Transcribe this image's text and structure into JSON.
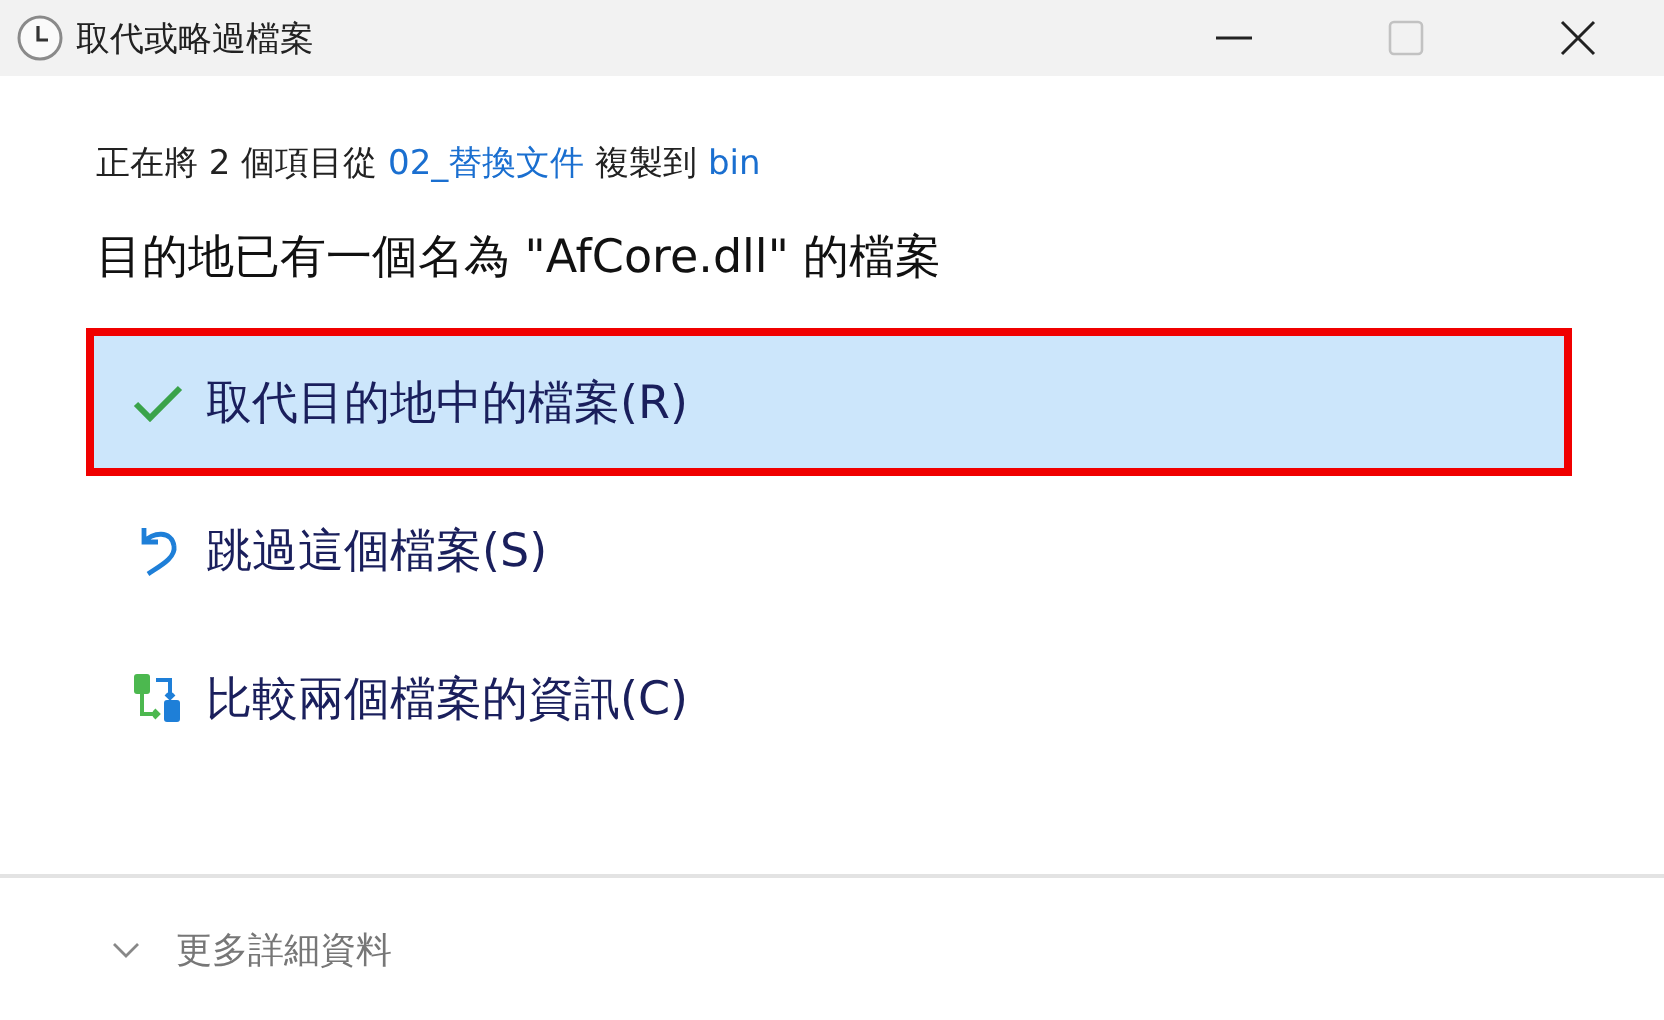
{
  "window": {
    "title": "取代或略過檔案"
  },
  "copy_status": [
    {
      "kind": "text",
      "text": "正在將 2 個項目從 "
    },
    {
      "kind": "link",
      "text": "02_替換文件"
    },
    {
      "kind": "text",
      "text": " 複製到 "
    },
    {
      "kind": "link",
      "text": "bin"
    }
  ],
  "message": "目的地已有一個名為 \"AfCore.dll\" 的檔案",
  "options": [
    {
      "kind": "replace",
      "label": "取代目的地中的檔案(R)",
      "selected": true
    },
    {
      "kind": "skip",
      "label": "跳過這個檔案(S)",
      "selected": false
    },
    {
      "kind": "compare",
      "label": "比較兩個檔案的資訊(C)",
      "selected": false
    }
  ],
  "details": {
    "label": "更多詳細資料",
    "expanded": false
  }
}
